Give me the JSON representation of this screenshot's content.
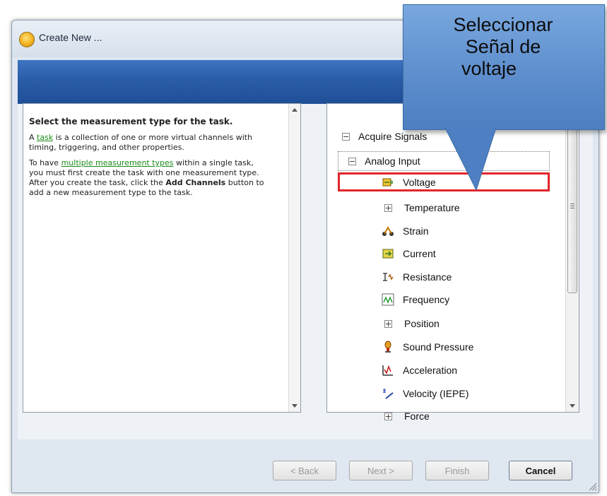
{
  "window": {
    "title": "Create New ..."
  },
  "help": {
    "heading": "Select the measurement type for the task.",
    "p1_prefix": "A ",
    "p1_link": "task",
    "p1_suffix": " is a collection of one or more virtual channels with timing, triggering, and other properties.",
    "p2_prefix": "To have ",
    "p2_link": "multiple measurement types",
    "p2_middle": " within a single task, you must first create the task with one measurement type. After you create the task, click the ",
    "p2_bold": "Add Channels",
    "p2_suffix": " button to add a new measurement type to the task."
  },
  "tree": {
    "root": "Acquire Signals",
    "group": "Analog Input",
    "items": [
      {
        "label": "Voltage",
        "icon": "voltage-icon"
      },
      {
        "label": "Temperature",
        "icon": "expand-icon"
      },
      {
        "label": "Strain",
        "icon": "strain-icon"
      },
      {
        "label": "Current",
        "icon": "current-icon"
      },
      {
        "label": "Resistance",
        "icon": "resistance-icon"
      },
      {
        "label": "Frequency",
        "icon": "frequency-icon"
      },
      {
        "label": "Position",
        "icon": "expand-icon"
      },
      {
        "label": "Sound Pressure",
        "icon": "microphone-icon"
      },
      {
        "label": "Acceleration",
        "icon": "acceleration-icon"
      },
      {
        "label": "Velocity (IEPE)",
        "icon": "velocity-icon"
      },
      {
        "label": "Force",
        "icon": "expand-icon"
      }
    ],
    "selected": "Voltage"
  },
  "buttons": {
    "back": "< Back",
    "next": "Next >",
    "finish": "Finish",
    "cancel": "Cancel"
  },
  "callout": {
    "line1": "Seleccionar",
    "line2": "Señal de",
    "line3": "voltaje"
  },
  "colors": {
    "banner": "#2a5ca8",
    "callout": "#5c8ccb",
    "highlight": "#e2252b",
    "link": "#1a8a1a"
  }
}
